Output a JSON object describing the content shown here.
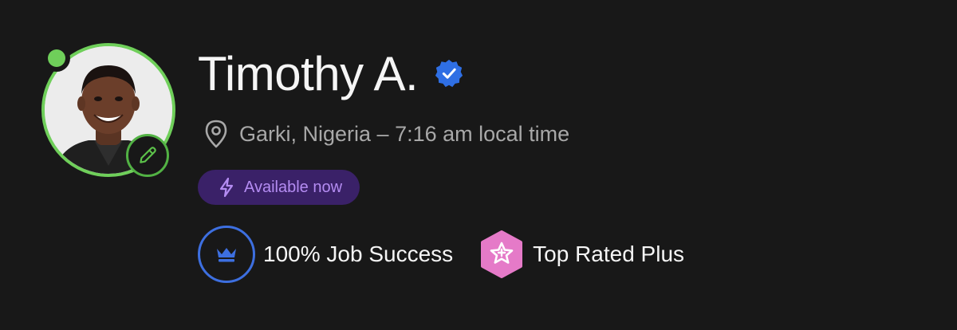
{
  "profile": {
    "name": "Timothy A.",
    "location": "Garki, Nigeria – 7:16 am local time",
    "availability": "Available now",
    "badges": {
      "job_success": "100% Job Success",
      "top_rated": "Top Rated Plus"
    }
  },
  "icons": {
    "online_status": "online-dot",
    "edit": "pencil-icon",
    "verified": "verified-check-icon",
    "location": "map-pin-icon",
    "availability": "lightning-bolt-icon",
    "job_success": "crown-icon",
    "top_rated": "star-hexagon-icon"
  },
  "colors": {
    "background": "#181818",
    "online_green": "#6fcf5a",
    "verified_blue": "#2f6fe4",
    "availability_bg": "#3a2168",
    "availability_text": "#b48cf2",
    "job_success_blue": "#3d6fe0",
    "top_rated_pink": "#e57ac8"
  }
}
